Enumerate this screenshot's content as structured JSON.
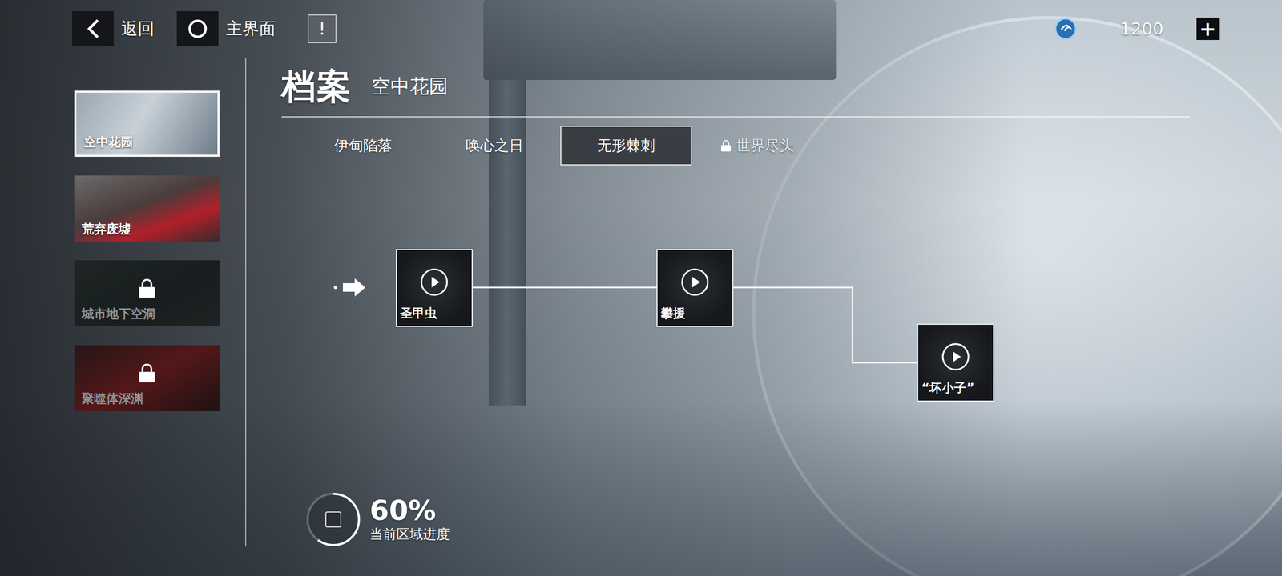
{
  "top_bar": {
    "back_label": "返回",
    "home_label": "主界面",
    "info_icon": "!",
    "currency": "1200",
    "add_button": "+"
  },
  "sidebar": {
    "items": [
      {
        "label": "空中花园",
        "selected": true,
        "locked": false
      },
      {
        "label": "荒弃废墟",
        "selected": false,
        "locked": false
      },
      {
        "label": "城市地下空洞",
        "selected": false,
        "locked": true
      },
      {
        "label": "聚噬体深渊",
        "selected": false,
        "locked": true
      }
    ]
  },
  "header": {
    "title": "档案",
    "subtitle": "空中花园"
  },
  "chapter_tabs": [
    {
      "label": "伊甸陷落",
      "selected": false,
      "locked": false
    },
    {
      "label": "唤心之日",
      "selected": false,
      "locked": false
    },
    {
      "label": "无形棘刺",
      "selected": true,
      "locked": false
    },
    {
      "label": "世界尽头",
      "selected": false,
      "locked": true
    }
  ],
  "nodes": [
    {
      "label": "圣甲虫"
    },
    {
      "label": "攀援"
    },
    {
      "label": "“坏小子”"
    }
  ],
  "progress": {
    "percent": "60%",
    "label": "当前区域进度",
    "level": 0.6
  }
}
